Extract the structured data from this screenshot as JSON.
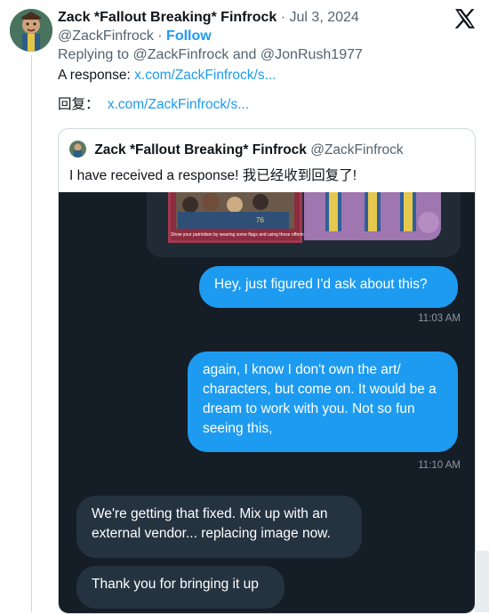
{
  "tweet": {
    "author_name": "Zack *Fallout Breaking* Finfrock",
    "date": "Jul 3, 2024",
    "handle": "@ZackFinfrock",
    "follow_label": "Follow",
    "replying_label": "Replying to",
    "reply_handles": "@ZackFinfrock and @JonRush1977",
    "response_label": "A response:",
    "response_link": "x.com/ZackFinfrock/s...",
    "cn_label": "回复：",
    "cn_link": "x.com/ZackFinfrock/s..."
  },
  "quoted": {
    "author_name": "Zack *Fallout Breaking* Finfrock",
    "handle": "@ZackFinfrock",
    "text": "I have received a response! 我已经收到回复了!"
  },
  "dm": {
    "image_caption": "Show your patriotism by wearing some flags and using these offerings.",
    "messages": [
      {
        "text": "Hey, just figured I'd ask about this?",
        "time": "11:03 AM"
      },
      {
        "text": "again, I know I don't own the art/ characters, but come on. It would be a dream to work with you. Not so fun seeing this,",
        "time": "11:10 AM"
      },
      {
        "text": "We're getting that fixed.  Mix up with an external vendor... replacing image now."
      },
      {
        "text": "Thank you for bringing it up"
      }
    ]
  },
  "icons": {
    "logo": "x-logo",
    "avatar": "avatar"
  },
  "colors": {
    "link": "#1d9bf0",
    "dm_background": "#151d27",
    "sent_bubble": "#1d9bf0",
    "received_bubble": "#253341"
  }
}
